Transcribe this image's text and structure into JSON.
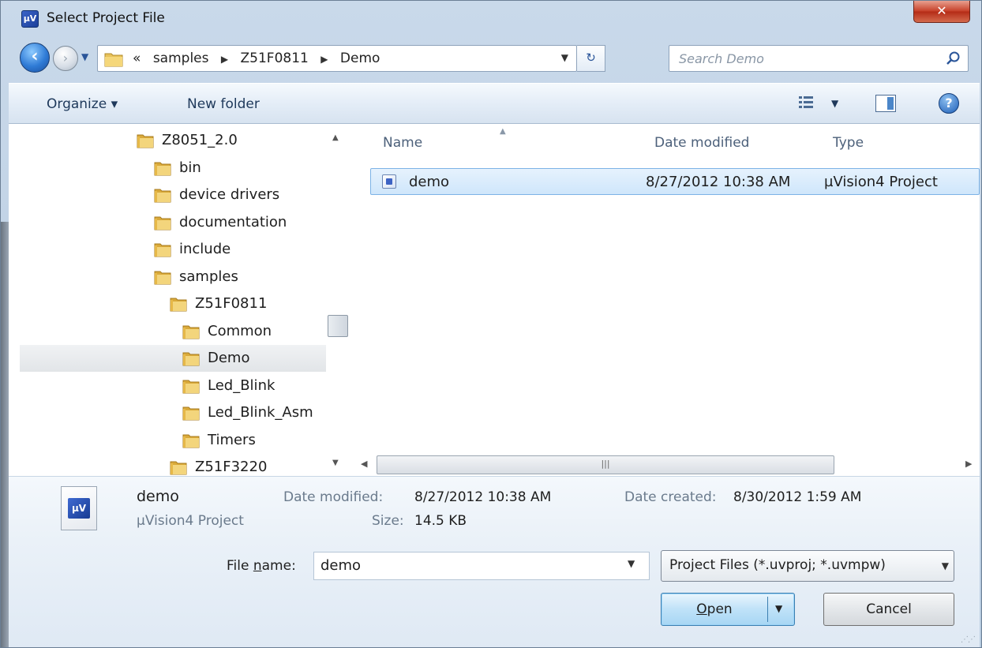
{
  "window": {
    "title": "Select Project File",
    "app_icon": "uv4-logo-icon",
    "close_label": "✕"
  },
  "nav": {
    "back_icon": "back-arrow-icon",
    "forward_icon": "forward-arrow-icon",
    "overflow": "«",
    "breadcrumbs": [
      "samples",
      "Z51F0811",
      "Demo"
    ],
    "search_placeholder": "Search Demo"
  },
  "toolbar": {
    "organize_label": "Organize ▾",
    "new_folder_label": "New folder"
  },
  "tree": {
    "items": [
      {
        "label": "Z8051_2.0",
        "indent": 0,
        "selected": false
      },
      {
        "label": "bin",
        "indent": 1,
        "selected": false
      },
      {
        "label": "device drivers",
        "indent": 1,
        "selected": false
      },
      {
        "label": "documentation",
        "indent": 1,
        "selected": false
      },
      {
        "label": "include",
        "indent": 1,
        "selected": false
      },
      {
        "label": "samples",
        "indent": 1,
        "selected": false
      },
      {
        "label": "Z51F0811",
        "indent": 2,
        "selected": false
      },
      {
        "label": "Common",
        "indent": 3,
        "selected": false
      },
      {
        "label": "Demo",
        "indent": 3,
        "selected": true
      },
      {
        "label": "Led_Blink",
        "indent": 3,
        "selected": false
      },
      {
        "label": "Led_Blink_Asm",
        "indent": 3,
        "selected": false
      },
      {
        "label": "Timers",
        "indent": 3,
        "selected": false
      },
      {
        "label": "Z51F3220",
        "indent": 2,
        "selected": false
      }
    ]
  },
  "files": {
    "columns": [
      "Name",
      "Date modified",
      "Type"
    ],
    "rows": [
      {
        "name": "demo",
        "date": "8/27/2012 10:38 AM",
        "type": "µVision4 Project"
      }
    ]
  },
  "details": {
    "name": "demo",
    "type": "µVision4 Project",
    "date_modified_label": "Date modified:",
    "date_modified": "8/27/2012 10:38 AM",
    "size_label": "Size:",
    "size": "14.5 KB",
    "date_created_label": "Date created:",
    "date_created": "8/30/2012 1:59 AM"
  },
  "bottom": {
    "file_name_label": "File name:",
    "file_name_value": "demo",
    "filter_value": "Project Files (*.uvproj; *.uvmpw)",
    "open_label": "Open",
    "cancel_label": "Cancel"
  },
  "colors": {
    "accent": "#3c7fb1",
    "selection": "#cfe6fb",
    "folder": "#e8c25a"
  }
}
